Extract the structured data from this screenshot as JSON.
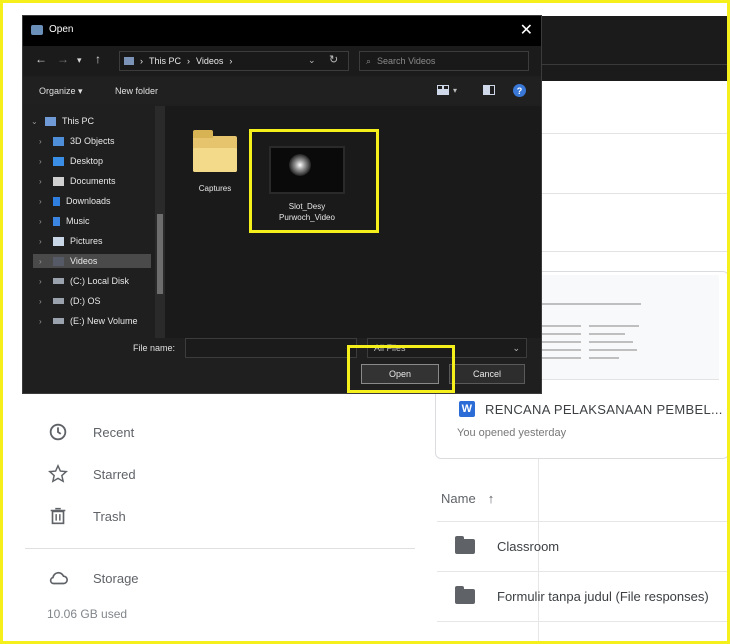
{
  "dialog": {
    "title": "Open",
    "close_glyph": "✕",
    "breadcrumb": [
      "This PC",
      "Videos"
    ],
    "search_placeholder": "Search Videos",
    "organize_label": "Organize ▾",
    "new_folder_label": "New folder",
    "help_glyph": "?",
    "tree": [
      {
        "label": "This PC",
        "icon": "pc-icon",
        "level": 0
      },
      {
        "label": "3D Objects",
        "icon": "folder-3d-icon",
        "level": 1
      },
      {
        "label": "Desktop",
        "icon": "desktop-icon",
        "level": 1
      },
      {
        "label": "Documents",
        "icon": "documents-icon",
        "level": 1
      },
      {
        "label": "Downloads",
        "icon": "downloads-icon",
        "level": 1
      },
      {
        "label": "Music",
        "icon": "music-icon",
        "level": 1
      },
      {
        "label": "Pictures",
        "icon": "pictures-icon",
        "level": 1
      },
      {
        "label": "Videos",
        "icon": "videos-icon",
        "level": 1,
        "selected": true
      },
      {
        "label": "(C:) Local Disk",
        "icon": "drive-icon",
        "level": 1
      },
      {
        "label": "(D:) OS",
        "icon": "drive-icon",
        "level": 1
      },
      {
        "label": "(E:) New Volume",
        "icon": "drive-icon",
        "level": 1
      }
    ],
    "files": [
      {
        "name": "Captures",
        "type": "folder"
      },
      {
        "name_line1": "Slot_Desy",
        "name_line2": "Purwoch_Video",
        "type": "video"
      }
    ],
    "file_name_label": "File name:",
    "file_name_value": "",
    "filter_value": "All Files",
    "open_label": "Open",
    "cancel_label": "Cancel"
  },
  "drive": {
    "preview": {
      "title": "RENCANA PELAKSANAAN PEMBEL...",
      "subtitle": "You opened yesterday",
      "word_icon_letter": "W"
    },
    "nav": [
      {
        "label": "Recent",
        "icon": "clock-icon"
      },
      {
        "label": "Starred",
        "icon": "star-icon"
      },
      {
        "label": "Trash",
        "icon": "trash-icon"
      }
    ],
    "storage_label": "Storage",
    "storage_used": "10.06 GB used",
    "list_header": "Name",
    "sort_glyph": "↑",
    "rows": [
      "Classroom",
      "Formulir tanpa judul (File responses)"
    ]
  },
  "colors": {
    "highlight": "#f5ef1c",
    "dialog_bg": "#1f1f1f",
    "word_blue": "#2b6cd6"
  }
}
